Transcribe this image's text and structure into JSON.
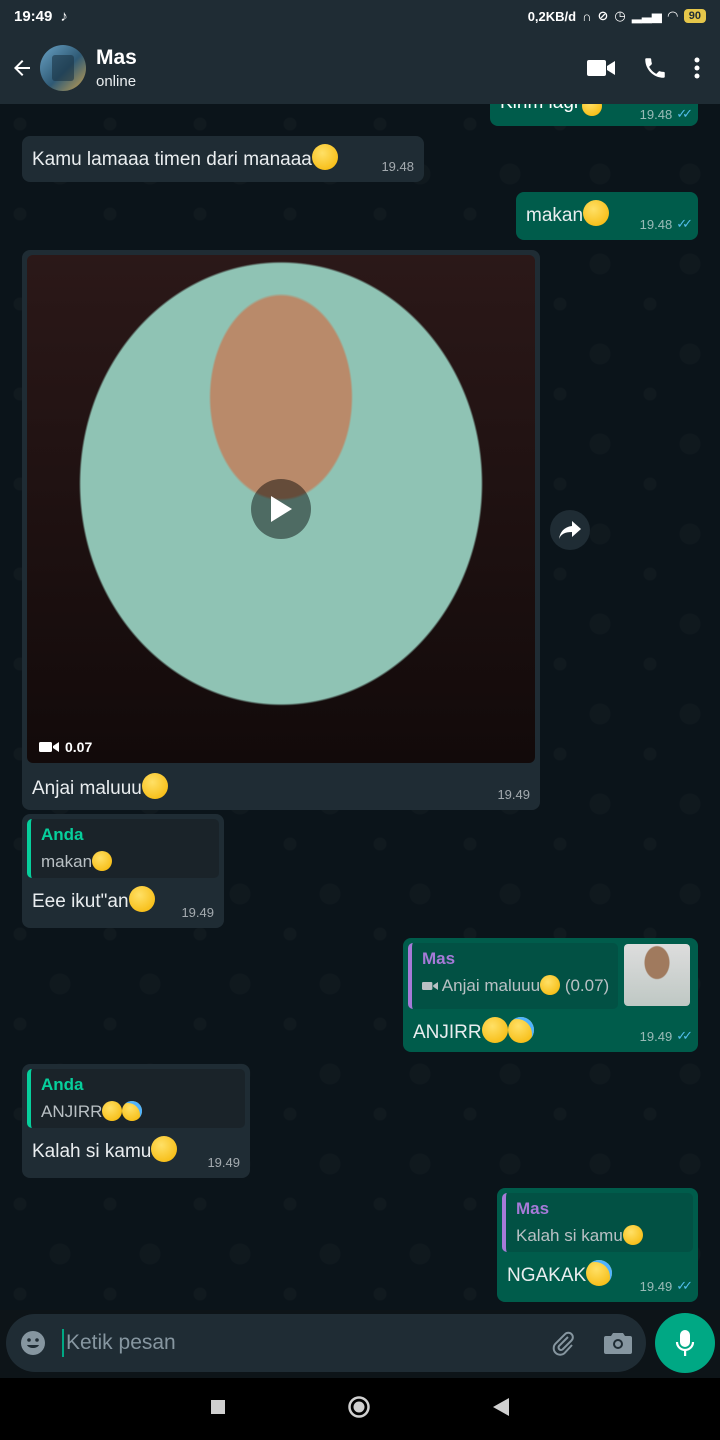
{
  "status_bar": {
    "time": "19:49",
    "network_speed": "0,2KB/d",
    "battery": "90"
  },
  "header": {
    "contact_name": "Mas",
    "contact_status": "online"
  },
  "messages": {
    "m0": {
      "text": "Kirim lagi",
      "time": "19.48"
    },
    "m1": {
      "text": "Kamu lamaaa timen dari manaaa",
      "time": "19.48"
    },
    "m2": {
      "text": "makan",
      "time": "19.48"
    },
    "m3": {
      "duration": "0.07",
      "caption": "Anjai maluuu",
      "time": "19.49"
    },
    "m4": {
      "quote_author": "Anda",
      "quote_text": "makan",
      "text": "Eee ikut\"an",
      "time": "19.49"
    },
    "m5": {
      "quote_author": "Mas",
      "quote_text": "Anjai maluuu",
      "quote_duration": "(0.07)",
      "text": "ANJIRR",
      "time": "19.49"
    },
    "m6": {
      "quote_author": "Anda",
      "quote_text": "ANJIRR",
      "text": "Kalah si kamu",
      "time": "19.49"
    },
    "m7": {
      "quote_author": "Mas",
      "quote_text": "Kalah si kamu",
      "text": "NGAKAK",
      "time": "19.49"
    }
  },
  "composer": {
    "placeholder": "Ketik pesan"
  },
  "icons": [
    "back-arrow-icon",
    "video-call-icon",
    "phone-icon",
    "more-vert-icon",
    "play-icon",
    "video-camera-icon",
    "share-icon",
    "emoji-icon",
    "attach-icon",
    "camera-icon",
    "mic-icon"
  ],
  "colors": {
    "incoming_bubble": "#1f2c34",
    "outgoing_bubble": "#005c4b",
    "accent": "#00a884",
    "read_ticks": "#53bdeb",
    "quote_self": "#06cf9c",
    "quote_contact": "#a67ad8"
  }
}
